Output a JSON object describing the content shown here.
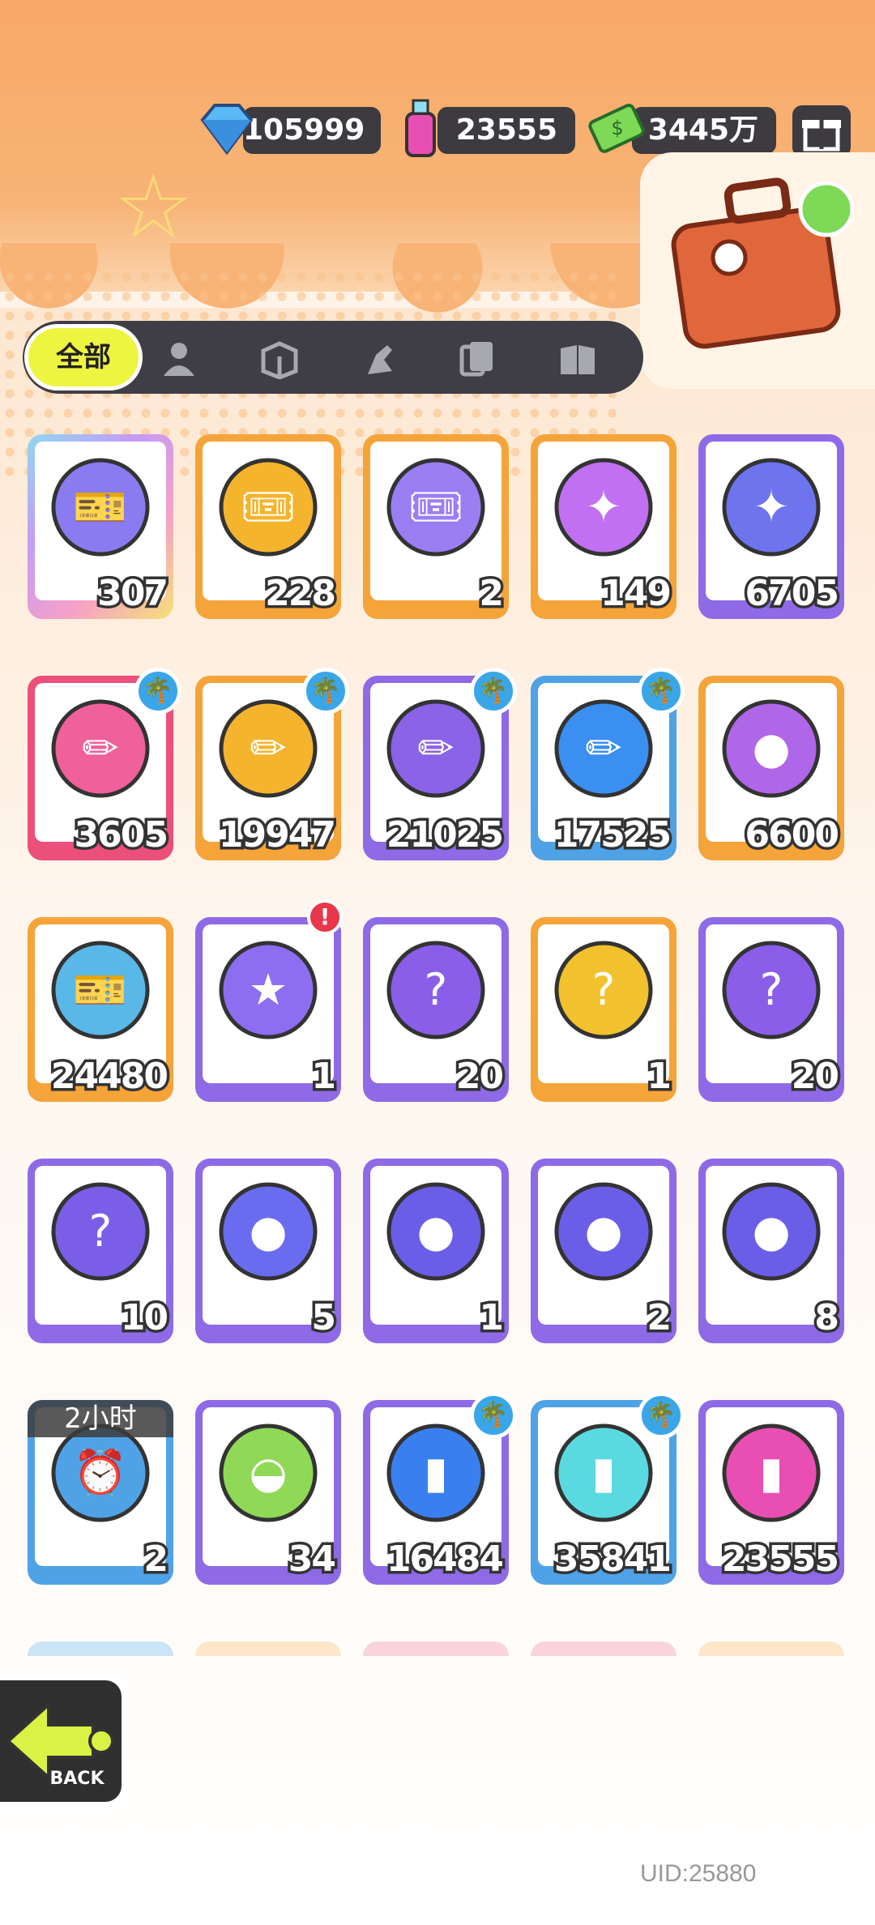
{
  "currencies": {
    "diamond": {
      "icon": "diamond-icon",
      "value": "105999"
    },
    "paint": {
      "icon": "spray-can-icon",
      "value": "23555"
    },
    "money": {
      "icon": "cash-icon",
      "value": "3445万"
    }
  },
  "tabs": {
    "active_label": "全部",
    "icons": [
      "person-icon",
      "box-icon",
      "hand-icon",
      "cards-icon",
      "book-icon"
    ]
  },
  "items": [
    {
      "name": "color-ticket-rainbow",
      "count": "307",
      "border": "rainbow"
    },
    {
      "name": "ticket-gold",
      "count": "228",
      "border": "orange"
    },
    {
      "name": "ticket-purple",
      "count": "2",
      "border": "orange"
    },
    {
      "name": "rainbow-star",
      "count": "149",
      "border": "orange"
    },
    {
      "name": "blue-star",
      "count": "6705",
      "border": "purple"
    },
    {
      "name": "pink-crayon",
      "count": "3605",
      "border": "pink",
      "palm": true
    },
    {
      "name": "yellow-crayon",
      "count": "19947",
      "border": "orange",
      "palm": true
    },
    {
      "name": "purple-crayon",
      "count": "21025",
      "border": "purple",
      "palm": true
    },
    {
      "name": "blue-crayon",
      "count": "17525",
      "border": "blue",
      "palm": true
    },
    {
      "name": "cool-badge",
      "count": "6600",
      "border": "orange"
    },
    {
      "name": "season-ticket",
      "count": "24480",
      "border": "orange"
    },
    {
      "name": "travel-card",
      "count": "1",
      "border": "purple",
      "alert": true
    },
    {
      "name": "mystery-egg",
      "count": "20",
      "border": "purple"
    },
    {
      "name": "deity-mystery-gold",
      "count": "1",
      "border": "orange"
    },
    {
      "name": "deity-mystery-purple",
      "count": "20",
      "border": "purple"
    },
    {
      "name": "travel-card-mystery",
      "count": "10",
      "border": "purple"
    },
    {
      "name": "pet-ball-fish",
      "count": "5",
      "border": "purple"
    },
    {
      "name": "pet-ball-piranha",
      "count": "1",
      "border": "purple"
    },
    {
      "name": "pet-ball-jelly",
      "count": "2",
      "border": "purple"
    },
    {
      "name": "pet-ball-plant",
      "count": "8",
      "border": "purple"
    },
    {
      "name": "alarm-clock",
      "count": "2",
      "border": "blue",
      "timer": "2小时"
    },
    {
      "name": "green-cup",
      "count": "34",
      "border": "purple"
    },
    {
      "name": "blue-spray-can",
      "count": "16484",
      "border": "purple",
      "palm": true
    },
    {
      "name": "paint-tube",
      "count": "35841",
      "border": "blue",
      "palm": true
    },
    {
      "name": "pink-spray-can",
      "count": "23555",
      "border": "purple"
    }
  ],
  "back": {
    "label": "BACK"
  },
  "uid": "UID:25880",
  "colors": {
    "orange": "#f5a43a",
    "purple": "#8e6ae6",
    "pink": "#ec4f79",
    "blue": "#4fa2e6",
    "rainbow": "#8fd9f0"
  }
}
